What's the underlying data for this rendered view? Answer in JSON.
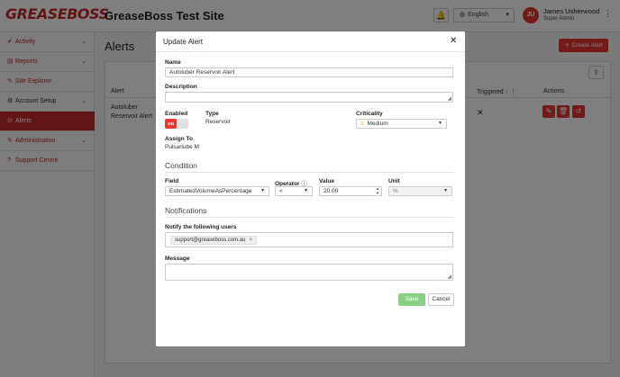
{
  "app": {
    "logo": "GREASEBOSS",
    "site_title": "GreaseBoss Test Site",
    "language": "English",
    "user_initials": "JU",
    "user_name": "James Usherwood",
    "user_role": "Super Admin"
  },
  "sidebar": {
    "items": [
      {
        "label": "Activity",
        "icon": "check-icon"
      },
      {
        "label": "Reports",
        "icon": "report-icon"
      },
      {
        "label": "Site Explorer",
        "icon": "pencil-icon"
      },
      {
        "label": "Account Setup",
        "icon": "gear-icon"
      },
      {
        "label": "Alerts",
        "icon": "alert-icon"
      },
      {
        "label": "Administration",
        "icon": "wrench-icon"
      },
      {
        "label": "Support Centre",
        "icon": "help-icon"
      }
    ]
  },
  "main": {
    "title": "Alerts",
    "create_label": "Create Alert",
    "columns": {
      "alert": "Alert",
      "triggered": "Triggered",
      "actions": "Actions"
    },
    "row": {
      "name": "Autoluber Reservoir Alert",
      "triggered": "✕"
    }
  },
  "modal": {
    "title": "Update Alert",
    "name_label": "Name",
    "name_value": "Autoluber Reservoir Alert",
    "description_label": "Description",
    "description_value": "",
    "enabled_label": "Enabled",
    "toggle_text": "ON",
    "type_label": "Type",
    "type_value": "Reservoir",
    "criticality_label": "Criticality",
    "criticality_value": "Medium",
    "assign_label": "Assign To",
    "assign_value": "Pulsarlube M",
    "condition_heading": "Condition",
    "field_label": "Field",
    "field_value": "EstimatedVolumeAsPercentage",
    "operator_label": "Operator",
    "operator_value": "<",
    "value_label": "Value",
    "value_value": "20.00",
    "unit_label": "Unit",
    "unit_value": "%",
    "notifications_heading": "Notifications",
    "notify_label": "Notify the following users",
    "notify_user": "support@greaseboss.com.au",
    "message_label": "Message",
    "message_value": "",
    "save_label": "Save",
    "cancel_label": "Cancel"
  }
}
